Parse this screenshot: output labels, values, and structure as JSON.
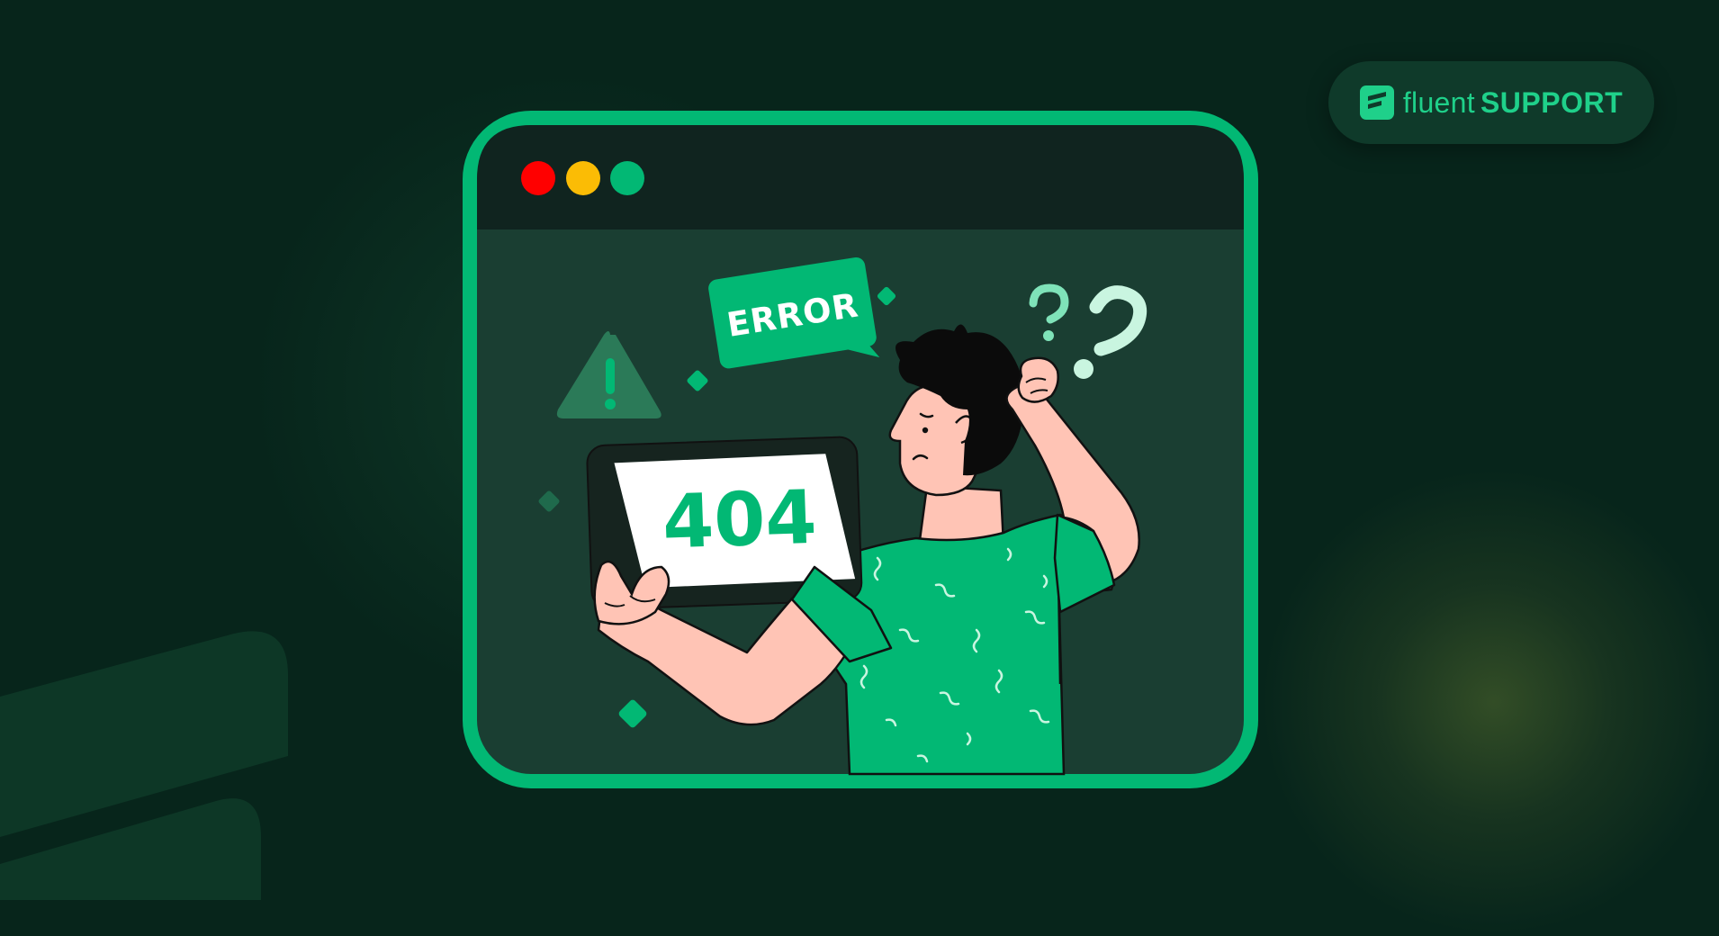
{
  "brand": {
    "name_light": "fluent",
    "name_bold": "SUPPORT",
    "icon": "fluent-support-logo-icon"
  },
  "illustration": {
    "window_controls": [
      "close-dot-red",
      "minimize-dot-yellow",
      "maximize-dot-green"
    ],
    "error_bubble_text": "ERROR",
    "tablet_screen_text": "404",
    "icons": [
      "warning-triangle-icon",
      "question-mark-icon",
      "diamond-sparkle-icon"
    ]
  },
  "colors": {
    "background": "#07251b",
    "accent": "#02b874",
    "window_body": "#1a3e32",
    "window_titlebar": "#10241f",
    "dot_red": "#ff0000",
    "dot_yellow": "#fbbc05",
    "dot_green": "#02b874",
    "skin": "#ffc4b5",
    "hair": "#0b0b0b"
  }
}
